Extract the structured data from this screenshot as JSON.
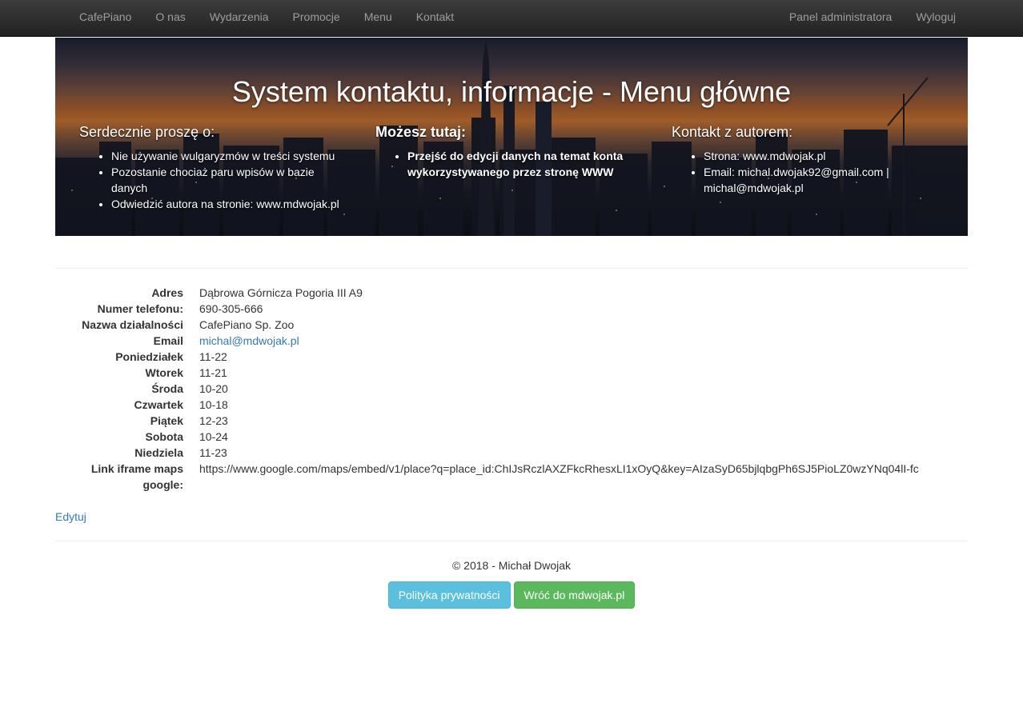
{
  "navbar": {
    "brand": "CafePiano",
    "left_items": [
      "O nas",
      "Wydarzenia",
      "Promocje",
      "Menu",
      "Kontakt"
    ],
    "right_items": [
      "Panel administratora",
      "Wyloguj"
    ]
  },
  "hero": {
    "title": "System kontaktu, informacje - Menu główne",
    "columns": [
      {
        "heading": "Serdecznie proszę o:",
        "items": [
          "Nie używanie wulgaryzmów w treści systemu",
          "Pozostanie chociaż paru wpisów w bazie danych",
          "Odwiedzić autora na stronie: www.mdwojak.pl"
        ]
      },
      {
        "heading": "Możesz tutaj:",
        "items": [
          "Przejść do edycji danych na temat konta wykorzystywanego przez stronę WWW"
        ]
      },
      {
        "heading": "Kontakt z autorem:",
        "items": [
          "Strona: www.mdwojak.pl",
          "Email: michal.dwojak92@gmail.com | michal@mdwojak.pl"
        ]
      }
    ]
  },
  "details": [
    {
      "label": "Adres",
      "value": "Dąbrowa Górnicza Pogoria III A9"
    },
    {
      "label": "Numer telefonu:",
      "value": "690-305-666"
    },
    {
      "label": "Nazwa działalności",
      "value": "CafePiano Sp. Zoo"
    },
    {
      "label": "Email",
      "value": "michal@mdwojak.pl"
    },
    {
      "label": "Poniedziałek",
      "value": "11-22"
    },
    {
      "label": "Wtorek",
      "value": "11-21"
    },
    {
      "label": "Środa",
      "value": "10-20"
    },
    {
      "label": "Czwartek",
      "value": "10-18"
    },
    {
      "label": "Piątek",
      "value": "12-23"
    },
    {
      "label": "Sobota",
      "value": "10-24"
    },
    {
      "label": "Niedziela",
      "value": "11-23"
    },
    {
      "label": "Link iframe maps google:",
      "value": "https://www.google.com/maps/embed/v1/place?q=place_id:ChIJsRczlAXZFkcRhesxLI1xOyQ&key=AIzaSyD65bjlqbgPh6SJ5PioLZ0wzYNq04lI-fc"
    }
  ],
  "edit_label": "Edytuj",
  "footer": {
    "copyright": "© 2018 - Michał Dwojak",
    "privacy_button": "Polityka prywatności",
    "back_button": "Wróć do mdwojak.pl"
  }
}
